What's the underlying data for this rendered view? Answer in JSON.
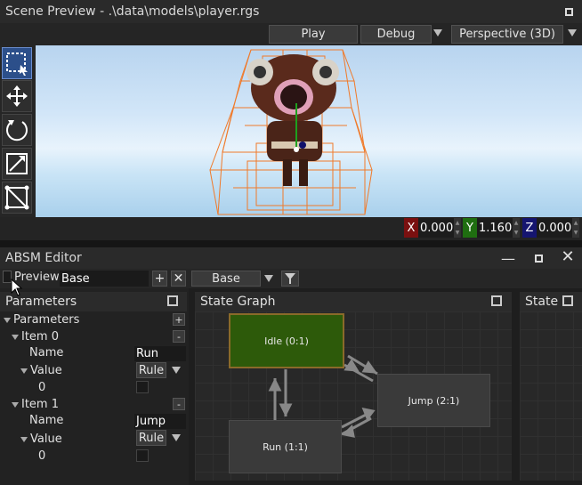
{
  "scene_preview": {
    "title": "Scene Preview - .\\data\\models\\player.rgs",
    "play_label": "Play",
    "debug_label": "Debug",
    "camera_mode": "Perspective (3D)",
    "tools": [
      "select-icon",
      "move-icon",
      "rotate-icon",
      "scale-icon",
      "navmesh-icon"
    ],
    "coords": {
      "x_label": "X",
      "x_value": "0.000",
      "y_label": "Y",
      "y_value": "1.160",
      "z_label": "Z",
      "z_value": "0.000"
    }
  },
  "absm_editor": {
    "title": "ABSM Editor",
    "preview_label": "Preview",
    "preview_value": "Base",
    "layer_select": "Base"
  },
  "parameters_panel": {
    "title": "Parameters",
    "root_label": "Parameters",
    "items": [
      {
        "label": "Item 0",
        "name_label": "Name",
        "name_value": "Run",
        "value_label": "Value",
        "value_type": "Rule",
        "value": "0"
      },
      {
        "label": "Item 1",
        "name_label": "Name",
        "name_value": "Jump",
        "value_label": "Value",
        "value_type": "Rule",
        "value": "0"
      }
    ]
  },
  "state_graph": {
    "title": "State Graph",
    "nodes": [
      {
        "label": "Idle (0:1)",
        "color": "#2d5a0a"
      },
      {
        "label": "Run (1:1)",
        "color": "#3a3a3a"
      },
      {
        "label": "Jump (2:1)",
        "color": "#3a3a3a"
      }
    ]
  },
  "state_panel": {
    "title": "State"
  },
  "colors": {
    "x_axis": "#7a1010",
    "y_axis": "#1f6e10",
    "z_axis": "#151570",
    "active_node": "#2d5a0a",
    "active_border": "#8a6a2a"
  }
}
